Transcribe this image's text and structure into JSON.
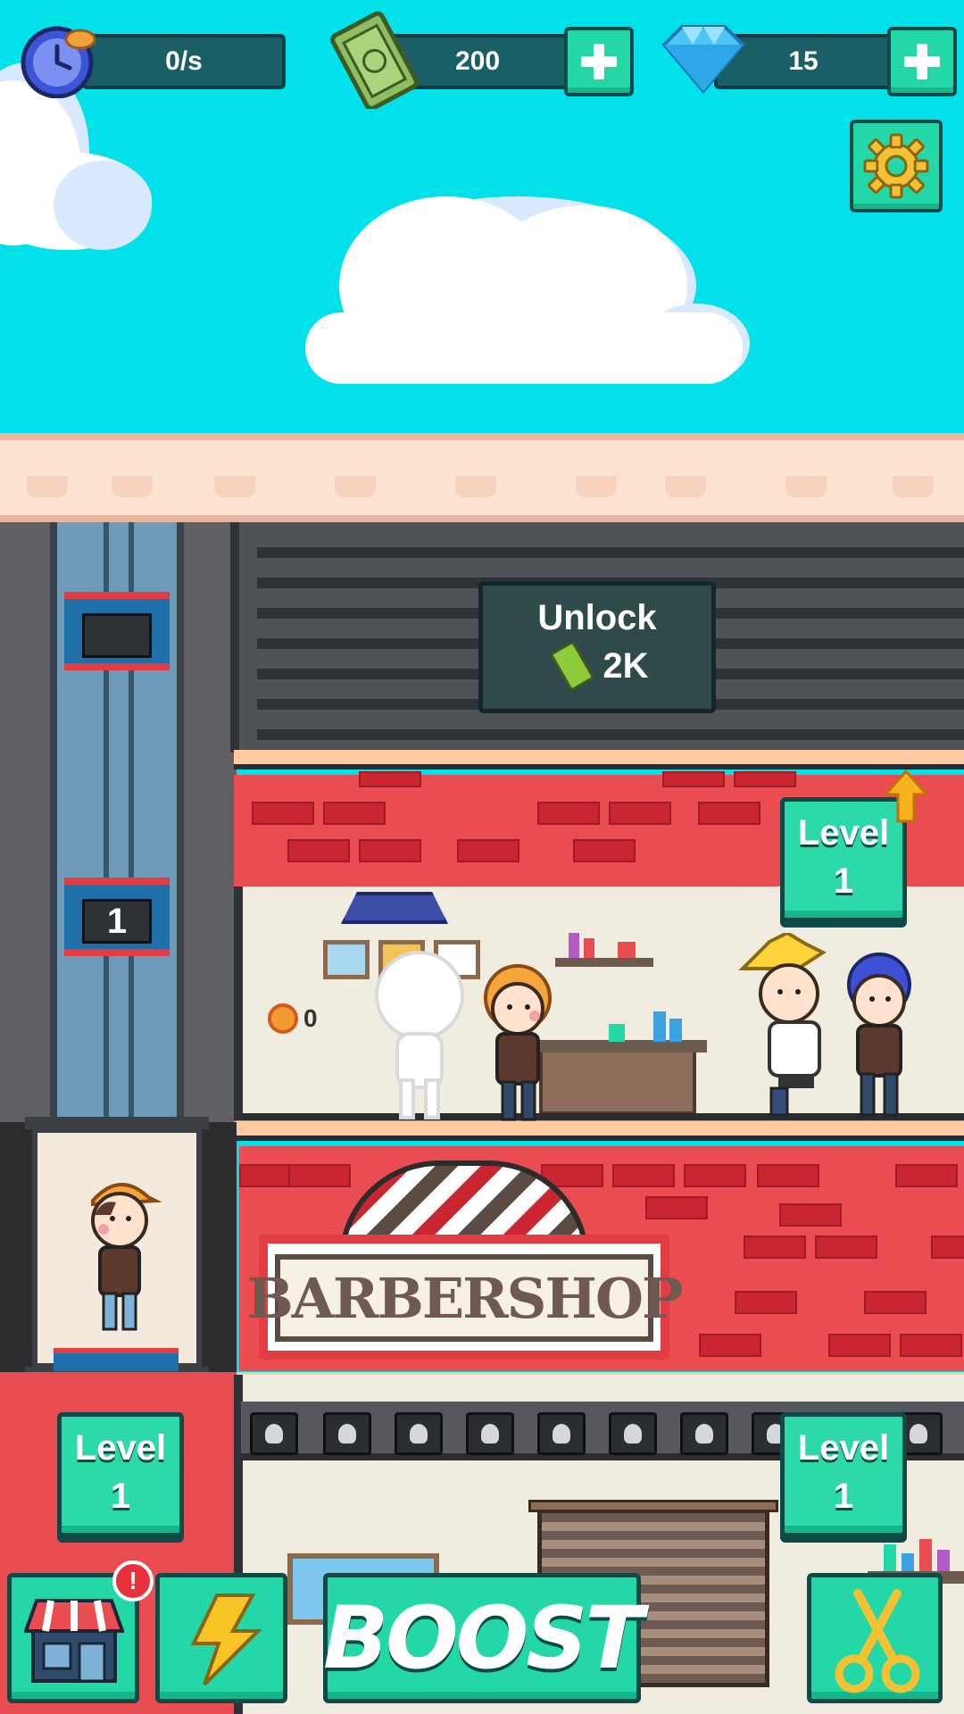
{
  "hud": {
    "income_rate": "0/s",
    "cash": "200",
    "gems": "15"
  },
  "locked_floor": {
    "title": "Unlock",
    "cost": "2K"
  },
  "elevator": {
    "floor_number": "1",
    "level_label": "Level",
    "level_value": "1"
  },
  "room1": {
    "level_label": "Level",
    "level_value": "1",
    "coins": "0"
  },
  "barbershop": {
    "sign": "BARBERSHOP"
  },
  "room2": {
    "level_label": "Level",
    "level_value": "1"
  },
  "bottom_bar": {
    "boost_label": "BOOST"
  },
  "colors": {
    "sky": "#00E1EA",
    "accent_green": "#23D7A7",
    "brick_red": "#E94D52",
    "alert_red": "#E8313F"
  }
}
